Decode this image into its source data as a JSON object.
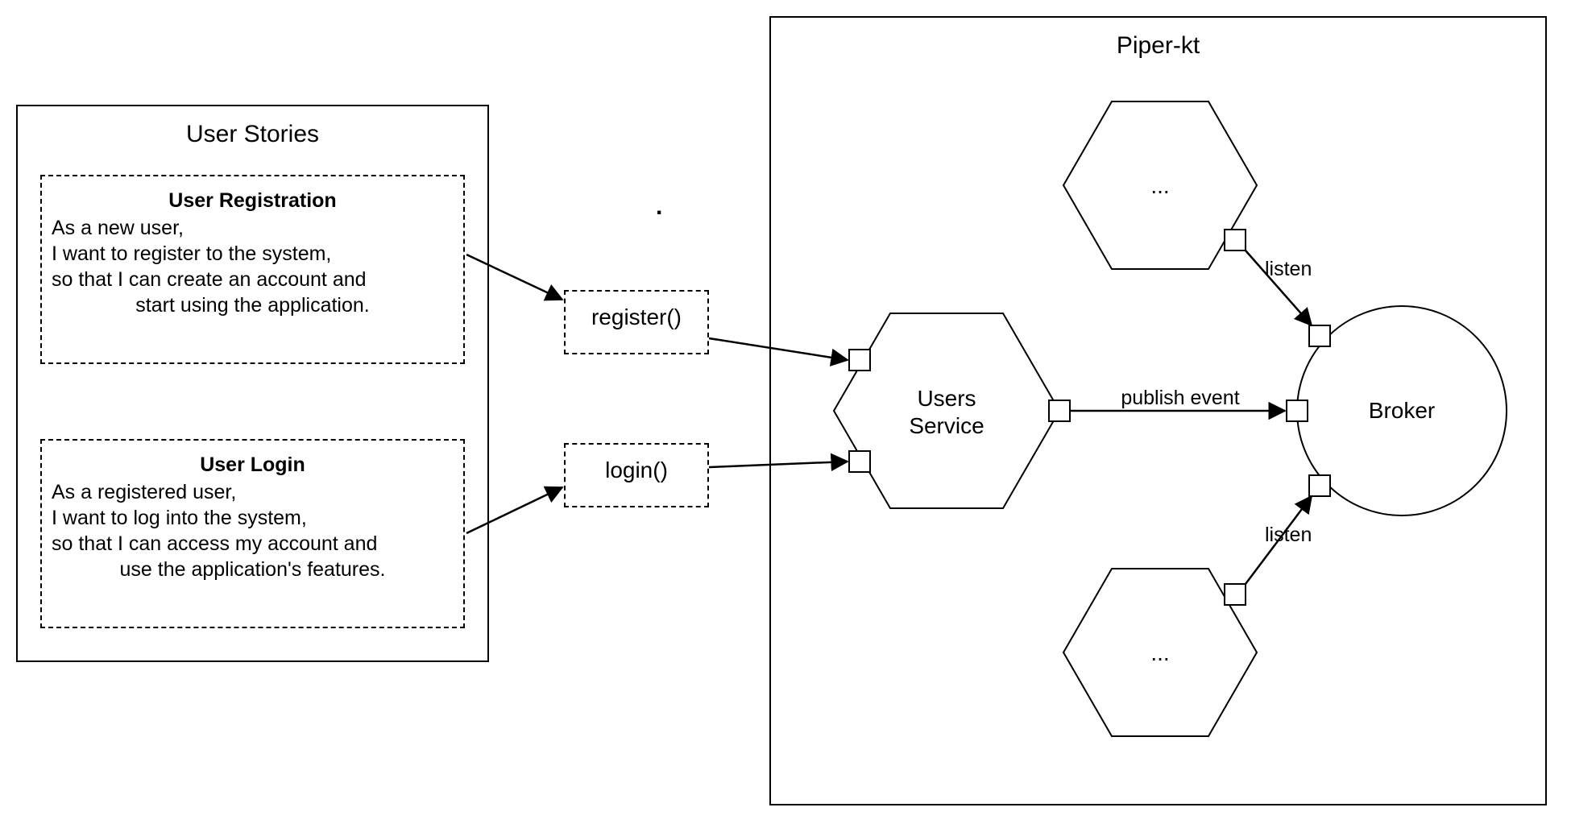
{
  "userStories": {
    "panelTitle": "User Stories",
    "registration": {
      "title": "User Registration",
      "line1": "As a new user,",
      "line2": "I want to register  to the system,",
      "line3": "so that I can create an account and",
      "line4": "start using the application."
    },
    "login": {
      "title": "User Login",
      "line1": "As a registered user,",
      "line2": "I want to log into the system,",
      "line3": "so that I can access my account and",
      "line4": "use the application's features."
    }
  },
  "methods": {
    "register": "register()",
    "login": "login()"
  },
  "piper": {
    "title": "Piper-kt",
    "usersService": "Users\nService",
    "broker": "Broker",
    "publishEvent": "publish event",
    "listenTop": "listen",
    "listenBottom": "listen",
    "hexTop": "...",
    "hexBottom": "..."
  }
}
